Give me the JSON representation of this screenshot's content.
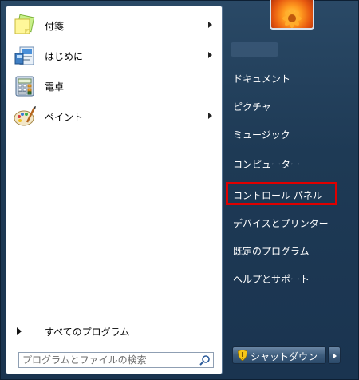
{
  "programs": [
    {
      "label": "付箋",
      "icon": "sticky-notes-icon",
      "has_submenu": true
    },
    {
      "label": "はじめに",
      "icon": "getting-started-icon",
      "has_submenu": true
    },
    {
      "label": "電卓",
      "icon": "calculator-icon",
      "has_submenu": false
    },
    {
      "label": "ペイント",
      "icon": "paint-icon",
      "has_submenu": true
    }
  ],
  "all_programs_label": "すべてのプログラム",
  "search": {
    "placeholder": "プログラムとファイルの検索"
  },
  "right_items": [
    {
      "label": "ドキュメント"
    },
    {
      "label": "ピクチャ"
    },
    {
      "label": "ミュージック"
    },
    {
      "label": "コンピューター"
    },
    {
      "label": "コントロール パネル",
      "highlighted": true
    },
    {
      "label": "デバイスとプリンター"
    },
    {
      "label": "既定のプログラム"
    },
    {
      "label": "ヘルプとサポート"
    }
  ],
  "shutdown_label": "シャットダウン",
  "colors": {
    "highlight": "#e00000",
    "menu_background": "#1e3a55"
  }
}
